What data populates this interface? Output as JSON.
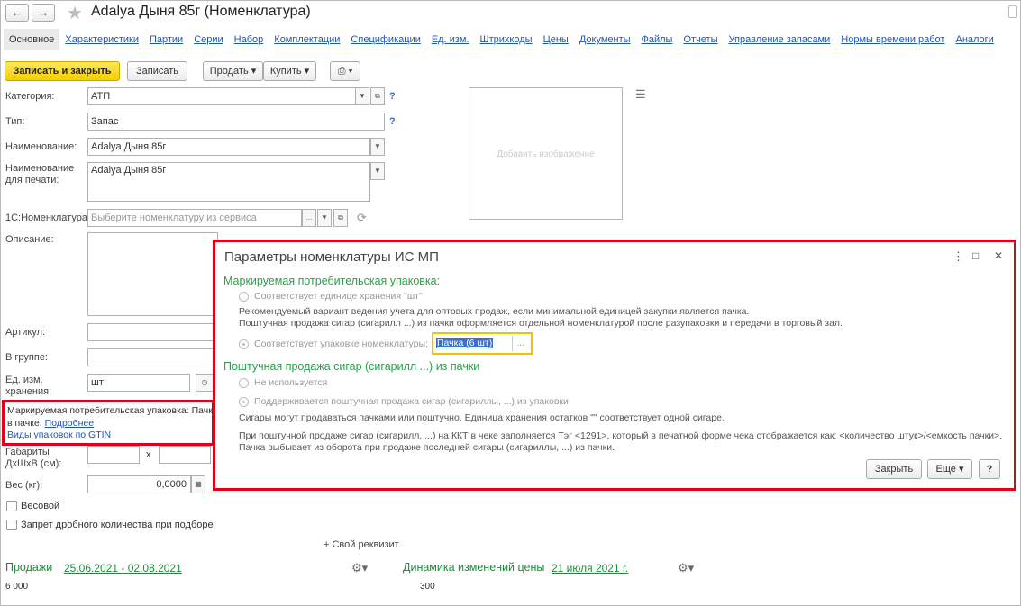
{
  "window": {
    "title": "Adalya Дыня 85г (Номенклатура)"
  },
  "nav": {
    "back": "←",
    "forward": "→",
    "star": "★"
  },
  "tabs": [
    "Основное",
    "Характеристики",
    "Партии",
    "Серии",
    "Набор",
    "Комплектации",
    "Спецификации",
    "Ед. изм.",
    "Штрихкоды",
    "Цены",
    "Документы",
    "Файлы",
    "Отчеты",
    "Управление запасами",
    "Нормы времени работ",
    "Аналоги"
  ],
  "toolbar": {
    "save_close": "Записать и закрыть",
    "save": "Записать",
    "sell": "Продать",
    "buy": "Купить",
    "print": "⎙"
  },
  "form": {
    "category_label": "Категория:",
    "category_value": "АТП",
    "type_label": "Тип:",
    "type_value": "Запас",
    "name_label": "Наименование:",
    "name_value": "Adalya Дыня 85г",
    "print_name_label_1": "Наименование",
    "print_name_label_2": "для печати:",
    "print_name_value": "Adalya Дыня 85г",
    "onec_label": "1С:Номенклатура:",
    "onec_placeholder": "Выберите номенклатуру из сервиса",
    "desc_label": "Описание:",
    "article_label": "Артикул:",
    "group_label": "В группе:",
    "unit_label_1": "Ед. изм.",
    "unit_label_2": "хранения:",
    "unit_value": "шт",
    "dims_label_1": "Габариты",
    "dims_label_2": "ДхШхВ (см):",
    "dims_x": "x",
    "weight_label": "Вес (кг):",
    "weight_value": "0,0000",
    "weighted_label": "Весовой",
    "fractional_label": "Запрет дробного количества при подборе",
    "own_attr": "+ Свой реквизит",
    "add_image": "Добавить изображение"
  },
  "note": {
    "line1": "Маркируемая потребительская упаковка: Пачка",
    "line2": "в пачке. ",
    "more_link": "Подробнее",
    "gtin_link": "Виды упаковок по GTIN"
  },
  "bottom": {
    "sales_label": "Продажи",
    "sales_period": "25.06.2021 - 02.08.2021",
    "sales_value": "6 000",
    "dynamics_label": "Динамика изменений цены",
    "dynamics_date": "21 июля 2021 г.",
    "dynamics_value": "300"
  },
  "dialog": {
    "title": "Параметры номенклатуры ИС МП",
    "section1": "Маркируемая потребительская упаковка:",
    "opt1": "Соответствует единице хранения \"шт\"",
    "opt1_desc_1": "Рекомендуемый вариант ведения учета для оптовых продаж, если минимальной единицей закупки является пачка.",
    "opt1_desc_2": "Поштучная продажа сигар (сигарилл ...) из пачки оформляется отдельной номенклатурой после разупаковки и передачи в торговый зал.",
    "opt2": "Соответствует упаковке номенклатуры:",
    "opt2_value": "Пачка (6 шт)",
    "section2": "Поштучная продажа сигар (сигарилл ...) из пачки",
    "opt3": "Не используется",
    "opt4": "Поддерживается поштучная продажа сигар (сигариллы, ...) из упаковки",
    "opt4_desc": "Сигары могут продаваться пачками или поштучно. Единица хранения остатков \"\" соответствует одной сигаре.",
    "info_1": "При поштучной продаже сигар (сигарилл, ...) на ККТ в чеке заполняется Тэг <1291>, который в печатной форме чека отображается как: <количество штук>/<емкость пачки>.",
    "info_2": "Пачка выбывает из оборота при продаже последней сигары (сигариллы, ...) из пачки.",
    "close_btn": "Закрыть",
    "more_btn": "Еще",
    "help_btn": "?",
    "menu_icon": "⋮",
    "max_icon": "□",
    "close_icon": "✕"
  }
}
